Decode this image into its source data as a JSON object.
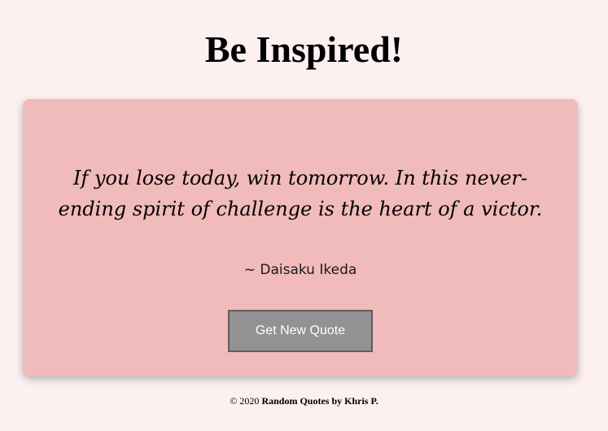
{
  "header": {
    "title": "Be Inspired!"
  },
  "quote": {
    "text": "If you lose today, win tomorrow. In this never-ending spirit of challenge is the heart of a victor.",
    "author": "~ Daisaku Ikeda"
  },
  "actions": {
    "new_quote_label": "Get New Quote"
  },
  "footer": {
    "copyright": "© 2020",
    "credit": "Random Quotes by Khris P."
  },
  "colors": {
    "page_background": "#fdf0f0",
    "card_background": "#f1babb",
    "button_background": "#939193",
    "button_text": "#ffffff"
  }
}
